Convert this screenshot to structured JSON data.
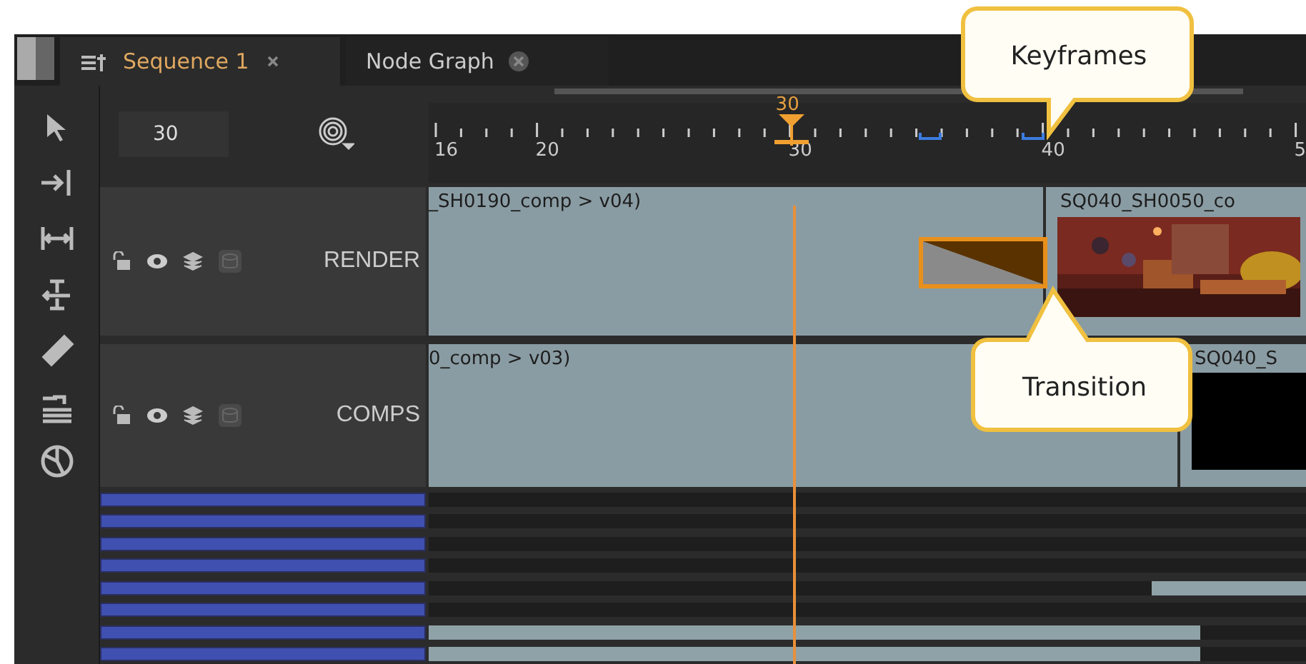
{
  "tabs": [
    {
      "label": "Sequence 1",
      "selected": true
    },
    {
      "label": "Node Graph",
      "selected": false
    }
  ],
  "frame_field": {
    "value": "30"
  },
  "ruler": {
    "labels": [
      "16",
      "20",
      "30",
      "40",
      "5"
    ],
    "playhead_label": "30"
  },
  "tracks": [
    {
      "name": "RENDER",
      "clips": [
        {
          "label": "_SH0190_comp > v04)",
          "kind": "plain"
        },
        {
          "label": "SQ040_SH0050_co",
          "kind": "picture"
        }
      ]
    },
    {
      "name": "COMPS",
      "clips": [
        {
          "label": "0_comp > v03)",
          "kind": "plain"
        },
        {
          "label": "SQ040_S",
          "kind": "black"
        }
      ]
    }
  ],
  "callouts": [
    {
      "text": "Keyframes"
    },
    {
      "text": "Transition"
    }
  ],
  "small_tracks": [
    {
      "kind": "empty"
    },
    {
      "kind": "empty"
    },
    {
      "kind": "empty"
    },
    {
      "kind": "empty"
    },
    {
      "kind": "tail"
    },
    {
      "kind": "empty"
    },
    {
      "kind": "long"
    },
    {
      "kind": "long"
    }
  ]
}
